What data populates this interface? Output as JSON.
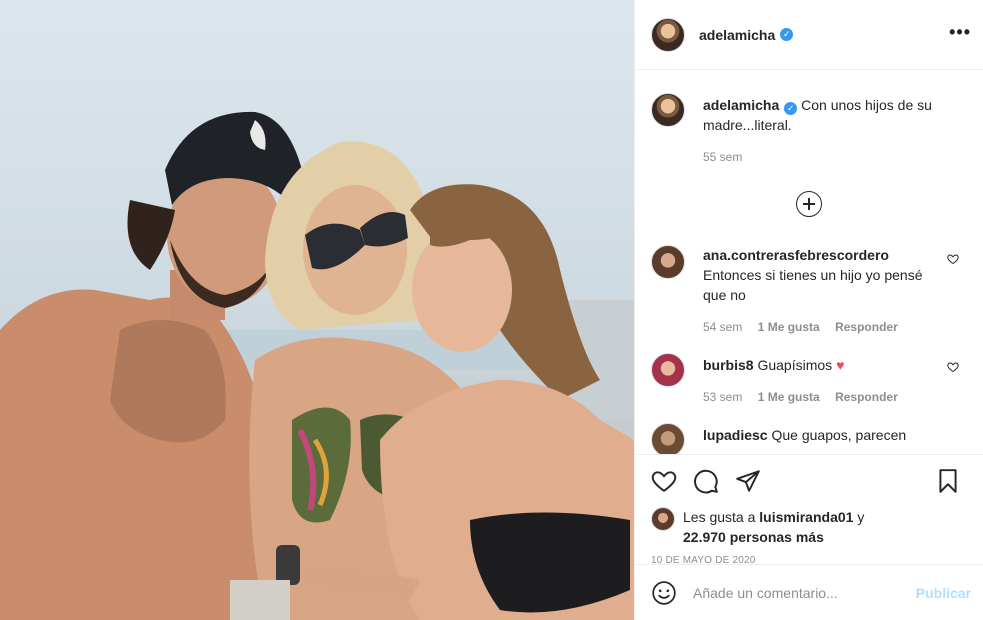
{
  "post": {
    "author": "adelamicha",
    "more_icon": "more-horizontal-icon",
    "caption": "Con unos hijos de su madre...literal.",
    "caption_time": "55 sem"
  },
  "comments": [
    {
      "username": "ana.contrerasfebrescordero",
      "text": "Entonces si tienes un hijo yo pensé que no",
      "time": "54 sem",
      "likes": "1 Me gusta",
      "reply": "Responder"
    },
    {
      "username": "burbis8",
      "text": "Guapísimos",
      "emoji": "♥",
      "time": "53 sem",
      "likes": "1 Me gusta",
      "reply": "Responder"
    },
    {
      "username": "lupadiesc",
      "text": "Que guapos, parecen"
    }
  ],
  "likes": {
    "prefix": "Les gusta a",
    "user": "luismiranda01",
    "connector": "y",
    "count": "22.970 personas más"
  },
  "date": "10 DE MAYO DE 2020",
  "add_comment": {
    "placeholder": "Añade un comentario...",
    "publish": "Publicar"
  },
  "colors": {
    "link_blue": "#3897f0",
    "publish_disabled": "#b2dffc",
    "muted": "#8e8e8e",
    "like_red": "#ed4956"
  },
  "icons": [
    "heart-icon",
    "comment-icon",
    "share-icon",
    "bookmark-icon",
    "emoji-icon",
    "plus-circle-icon",
    "verified-icon"
  ]
}
